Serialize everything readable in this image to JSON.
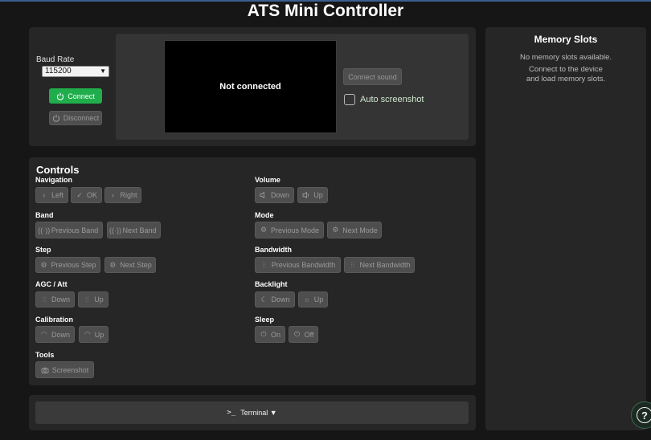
{
  "app": {
    "title": "ATS Mini Controller"
  },
  "connection": {
    "baud_label": "Baud Rate",
    "baud_value": "115200",
    "connect_label": "Connect",
    "disconnect_label": "Disconnect",
    "screen_status": "Not connected",
    "connect_sound_label": "Connect sound",
    "auto_screenshot_label": "Auto screenshot",
    "auto_screenshot_checked": false
  },
  "controls": {
    "title": "Controls",
    "navigation": {
      "label": "Navigation",
      "left": "Left",
      "ok": "OK",
      "right": "Right"
    },
    "volume": {
      "label": "Volume",
      "down": "Down",
      "up": "Up"
    },
    "band": {
      "label": "Band",
      "prev": "Previous Band",
      "next": "Next Band"
    },
    "mode": {
      "label": "Mode",
      "prev": "Previous Mode",
      "next": "Next Mode"
    },
    "step": {
      "label": "Step",
      "prev": "Previous Step",
      "next": "Next Step"
    },
    "bandwidth": {
      "label": "Bandwidth",
      "prev": "Previous Bandwidth",
      "next": "Next Bandwidth"
    },
    "agc": {
      "label": "AGC / Att",
      "down": "Down",
      "up": "Up"
    },
    "backlight": {
      "label": "Backlight",
      "down": "Down",
      "up": "Up"
    },
    "calibration": {
      "label": "Calibration",
      "down": "Down",
      "up": "Up"
    },
    "sleep": {
      "label": "Sleep",
      "on": "On",
      "off": "Off"
    },
    "tools": {
      "label": "Tools",
      "screenshot": "Screenshot"
    }
  },
  "terminal": {
    "label": "Terminal ▼"
  },
  "memory": {
    "title": "Memory Slots",
    "empty": "No memory slots available.",
    "hint_line1": "Connect to the device",
    "hint_line2": "and load memory slots."
  },
  "help": {
    "label": "?"
  },
  "colors": {
    "background": "#161616",
    "panel": "#262626",
    "connect_green": "#1fae4b",
    "disabled_button": "#4e4e4e"
  }
}
